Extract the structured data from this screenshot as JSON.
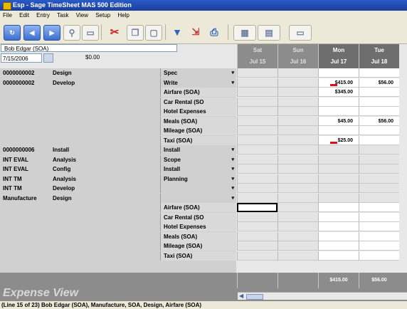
{
  "window": {
    "title": "Esp - Sage TimeSheet MAS 500 Edition"
  },
  "menu": [
    "File",
    "Edit",
    "Entry",
    "Task",
    "View",
    "Setup",
    "Help"
  ],
  "toolbar": {
    "icons": [
      "refresh-icon",
      "prev-icon",
      "next-icon",
      "find-icon",
      "doc-icon",
      "cut-icon",
      "copy-icon",
      "paste-icon",
      "filter-icon",
      "assign-icon",
      "print-icon",
      "grid-icon",
      "layout-icon",
      "window-icon"
    ]
  },
  "header": {
    "user": "Bob Edgar (SOA)",
    "date": "7/15/2006",
    "amount": "$0.00"
  },
  "days": [
    {
      "dow": "Sat",
      "date": "Jul 15",
      "active": false
    },
    {
      "dow": "Sun",
      "date": "Jul 16",
      "active": false
    },
    {
      "dow": "Mon",
      "date": "Jul 17",
      "active": true
    },
    {
      "dow": "Tue",
      "date": "Jul 18",
      "active": true
    }
  ],
  "rows": [
    {
      "project": "0000000002",
      "phase": "Design",
      "task": "Spec",
      "dropdown": true,
      "values": [
        "",
        "",
        "",
        ""
      ]
    },
    {
      "project": "0000000002",
      "phase": "Develop",
      "task": "Write",
      "dropdown": true,
      "values": [
        "",
        "",
        "$415.00",
        "$56.00"
      ]
    },
    {
      "project": "",
      "phase": "",
      "task": "Airfare (SOA)",
      "dropdown": false,
      "values": [
        "",
        "",
        "$345.00",
        ""
      ]
    },
    {
      "project": "",
      "phase": "",
      "task": "Car Rental (SO",
      "dropdown": false,
      "values": [
        "",
        "",
        "",
        ""
      ]
    },
    {
      "project": "",
      "phase": "",
      "task": "Hotel Expenses",
      "dropdown": false,
      "values": [
        "",
        "",
        "",
        ""
      ]
    },
    {
      "project": "",
      "phase": "",
      "task": "Meals (SOA)",
      "dropdown": false,
      "values": [
        "",
        "",
        "$45.00",
        "$56.00"
      ]
    },
    {
      "project": "",
      "phase": "",
      "task": "Mileage (SOA)",
      "dropdown": false,
      "values": [
        "",
        "",
        "",
        ""
      ]
    },
    {
      "project": "",
      "phase": "",
      "task": "Taxi (SOA)",
      "dropdown": false,
      "values": [
        "",
        "",
        "$25.00",
        ""
      ]
    },
    {
      "project": "0000000006",
      "phase": "Install",
      "task": "Install",
      "dropdown": true,
      "values": [
        "",
        "",
        "",
        ""
      ]
    },
    {
      "project": "INT EVAL",
      "phase": "Analysis",
      "task": "Scope",
      "dropdown": true,
      "values": [
        "",
        "",
        "",
        ""
      ]
    },
    {
      "project": "INT EVAL",
      "phase": "Config",
      "task": "Install",
      "dropdown": true,
      "values": [
        "",
        "",
        "",
        ""
      ]
    },
    {
      "project": "INT TM",
      "phase": "Analysis",
      "task": "Planning",
      "dropdown": true,
      "values": [
        "",
        "",
        "",
        ""
      ]
    },
    {
      "project": "INT TM",
      "phase": "Develop",
      "task": "",
      "dropdown": true,
      "values": [
        "",
        "",
        "",
        ""
      ]
    },
    {
      "project": "Manufacture",
      "phase": "Design",
      "task": "",
      "dropdown": true,
      "values": [
        "",
        "",
        "",
        ""
      ]
    },
    {
      "project": "",
      "phase": "",
      "task": "Airfare (SOA)",
      "dropdown": false,
      "values": [
        "",
        "",
        "",
        ""
      ]
    },
    {
      "project": "",
      "phase": "",
      "task": "Car Rental (SO",
      "dropdown": false,
      "values": [
        "",
        "",
        "",
        ""
      ]
    },
    {
      "project": "",
      "phase": "",
      "task": "Hotel Expenses",
      "dropdown": false,
      "values": [
        "",
        "",
        "",
        ""
      ]
    },
    {
      "project": "",
      "phase": "",
      "task": "Meals (SOA)",
      "dropdown": false,
      "values": [
        "",
        "",
        "",
        ""
      ]
    },
    {
      "project": "",
      "phase": "",
      "task": "Mileage (SOA)",
      "dropdown": false,
      "values": [
        "",
        "",
        "",
        ""
      ]
    },
    {
      "project": "",
      "phase": "",
      "task": "Taxi (SOA)",
      "dropdown": false,
      "values": [
        "",
        "",
        "",
        ""
      ]
    }
  ],
  "totals": [
    "",
    "",
    "$415.00",
    "$56.00"
  ],
  "view_label": "Expense View",
  "status": "(Line 15 of 23) Bob Edgar (SOA), Manufacture, SOA, Design, Airfare (SOA)"
}
